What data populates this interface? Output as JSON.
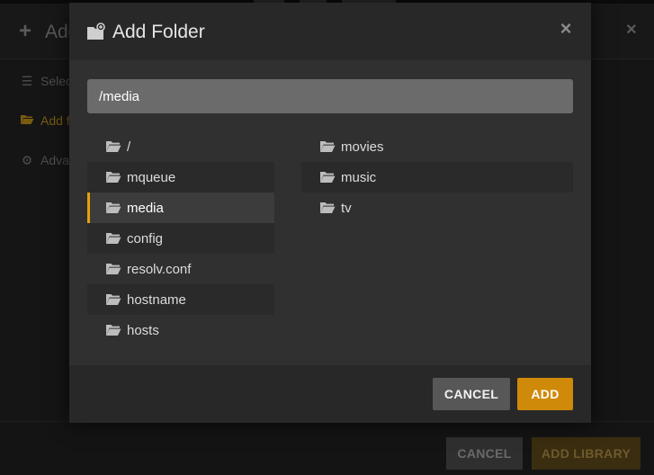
{
  "background_dialog": {
    "title": "Add",
    "nav": [
      {
        "label": "Select",
        "icon": "list-icon",
        "active": false
      },
      {
        "label": "Add f",
        "icon": "folder-open-icon",
        "active": true
      },
      {
        "label": "Adva",
        "icon": "gear-icon",
        "active": false
      }
    ],
    "cancel_label": "CANCEL",
    "add_library_label": "ADD LIBRARY"
  },
  "modal": {
    "title": "Add Folder",
    "title_icon": "folder-add-icon",
    "close_icon": "close-icon",
    "path_value": "/media",
    "left_column": [
      {
        "name": "/",
        "selected": false
      },
      {
        "name": "mqueue",
        "selected": false
      },
      {
        "name": "media",
        "selected": true
      },
      {
        "name": "config",
        "selected": false
      },
      {
        "name": "resolv.conf",
        "selected": false
      },
      {
        "name": "hostname",
        "selected": false
      },
      {
        "name": "hosts",
        "selected": false
      }
    ],
    "right_column": [
      {
        "name": "movies"
      },
      {
        "name": "music"
      },
      {
        "name": "tv"
      }
    ],
    "cancel_label": "CANCEL",
    "add_label": "ADD"
  },
  "colors": {
    "accent": "#e5a00d",
    "add_button": "#d08a0a",
    "modal_bg": "#303030",
    "input_bg": "#6b6b6b"
  }
}
